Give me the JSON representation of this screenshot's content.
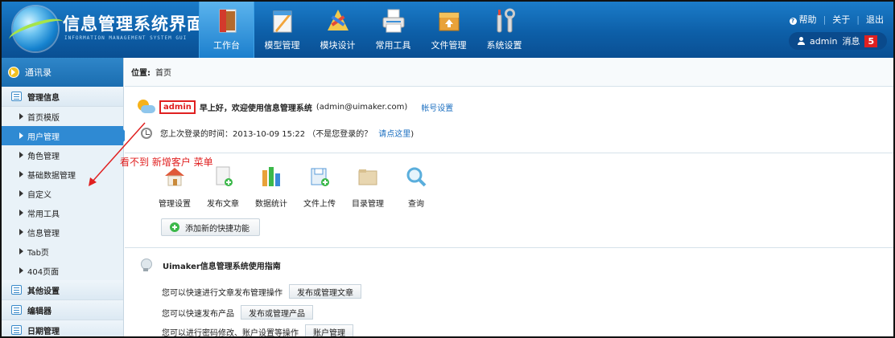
{
  "header": {
    "title": "信息管理系统界面",
    "subtitle": "INFORMATION MANAGEMENT SYSTEM GUI",
    "nav": [
      {
        "label": "工作台",
        "icon": "book-icon",
        "active": true
      },
      {
        "label": "模型管理",
        "icon": "model-icon",
        "active": false
      },
      {
        "label": "模块设计",
        "icon": "tools-icon",
        "active": false
      },
      {
        "label": "常用工具",
        "icon": "printer-icon",
        "active": false
      },
      {
        "label": "文件管理",
        "icon": "box-icon",
        "active": false
      },
      {
        "label": "系统设置",
        "icon": "wrench-icon",
        "active": false
      }
    ],
    "links": {
      "help": "帮助",
      "about": "关于",
      "logout": "退出"
    },
    "user": {
      "name": "admin",
      "messages_label": "消息",
      "messages_count": "5"
    }
  },
  "sidebar": {
    "head": "通讯录",
    "sections": [
      {
        "label": "管理信息",
        "items": [
          "首页模版",
          "用户管理",
          "角色管理",
          "基础数据管理",
          "自定义",
          "常用工具",
          "信息管理",
          "Tab页",
          "404页面"
        ],
        "active_item": "用户管理"
      },
      {
        "label": "其他设置"
      },
      {
        "label": "编辑器"
      },
      {
        "label": "日期管理"
      }
    ]
  },
  "breadcrumb": {
    "label": "位置:",
    "current": "首页"
  },
  "welcome": {
    "username": "admin",
    "greeting": "早上好，欢迎使用信息管理系统",
    "email": "(admin@uimaker.com)",
    "account_link": "帐号设置"
  },
  "last_login": {
    "text": "您上次登录的时间：2013-10-09 15:22 （不是您登录的？",
    "link": "请点这里",
    "close": ")"
  },
  "quick_actions": [
    {
      "label": "管理设置",
      "icon": "home-icon"
    },
    {
      "label": "发布文章",
      "icon": "doc-add-icon"
    },
    {
      "label": "数据统计",
      "icon": "stats-icon"
    },
    {
      "label": "文件上传",
      "icon": "upload-icon"
    },
    {
      "label": "目录管理",
      "icon": "folder-icon"
    },
    {
      "label": "查询",
      "icon": "search-icon"
    }
  ],
  "add_shortcut": "添加新的快捷功能",
  "guide": {
    "title": "Uimaker信息管理系统使用指南",
    "rows": [
      {
        "text": "您可以快速进行文章发布管理操作",
        "button": "发布或管理文章"
      },
      {
        "text": "您可以快速发布产品",
        "button": "发布或管理产品"
      },
      {
        "text": "您可以进行密码修改、账户设置等操作",
        "button": "账户管理"
      }
    ]
  },
  "annotation": "看不到 新增客户 菜单",
  "colors": {
    "accent": "#1b7cc9",
    "annotation": "#e02020",
    "active_item": "#2f8ad3"
  }
}
